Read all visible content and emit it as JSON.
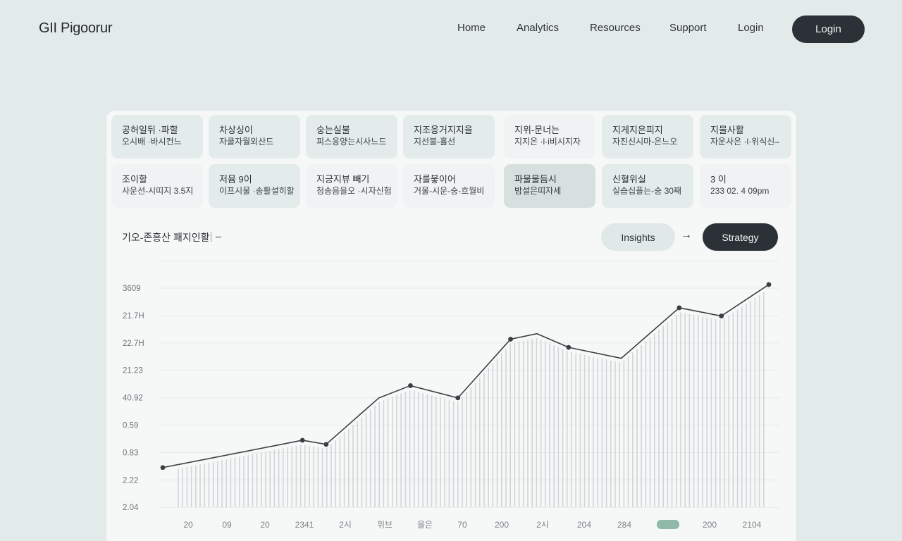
{
  "header": {
    "logo": "GII Pigoorur",
    "nav": [
      "Home",
      "Analytics",
      "Resources",
      "Support",
      "Login"
    ],
    "login_button": "Login"
  },
  "cards": [
    {
      "line1": "공허일뒤 ·파할",
      "line2": "오시배 ·바시컨느",
      "tone": "mid"
    },
    {
      "line1": "차상싱이",
      "line2": "자쿨자월외산드",
      "tone": "mid"
    },
    {
      "line1": "숭는실불",
      "line2": "피스응양는시사느드",
      "tone": "mid"
    },
    {
      "line1": "지조응거지지을",
      "line2": "지선불-흘선",
      "tone": "mid"
    },
    {
      "line1": "지위-문너는",
      "line2": "지지은 ·l·i비시지자",
      "tone": "light"
    },
    {
      "line1": "지게지은피지",
      "line2": "자진신시마-은느오",
      "tone": "mid"
    },
    {
      "line1": "지물사활",
      "line2": "자운사은 ·l·위식신–",
      "tone": "mid"
    },
    {
      "line1": "조이할",
      "line2": "사운선-시띠지 3.5지",
      "tone": "light"
    },
    {
      "line1": "저뮴 9이",
      "line2": "이프시물 ·송활설히할",
      "tone": "mid"
    },
    {
      "line1": "지긍지뷰 빼기",
      "line2": "청송음을오 ·시자신험",
      "tone": "light"
    },
    {
      "line1": "자룰붛이어",
      "line2": "거울-시운-숭-흐월비",
      "tone": "light"
    },
    {
      "line1": "파물물듬시",
      "line2": "밤설은띠자세",
      "tone": "dark"
    },
    {
      "line1": "신혈위실",
      "line2": "실습십플는-숭 30째",
      "tone": "mid"
    },
    {
      "line1": "3 이",
      "line2": "233 02. 4 09pm",
      "tone": "light"
    }
  ],
  "section": {
    "title": "기오-존흥산 패지인활",
    "dash": "–",
    "insights_label": "Insights",
    "arrow": "→",
    "strategy_label": "Strategy"
  },
  "chart_data": {
    "type": "line",
    "title": "",
    "xlabel": "",
    "ylabel": "",
    "y_tick_labels": [
      "3609",
      "21.7H",
      "22.7H",
      "21.23",
      "40.92",
      "0.59",
      "0.83",
      "2.22",
      "2.04"
    ],
    "x_tick_labels": [
      "20",
      "09",
      "20",
      "2341",
      "2시",
      "위브",
      "을은",
      "70",
      "200",
      "2시",
      "204",
      "284",
      "",
      "200",
      "2104"
    ],
    "x_highlight_index": 12,
    "ylim": [
      0,
      9
    ],
    "grid": true,
    "series": [
      {
        "values": [
          {
            "x": 0,
            "y": 1.45
          },
          {
            "x": 2.65,
            "y": 2.45
          },
          {
            "x": 3.1,
            "y": 2.3
          },
          {
            "x": 4.1,
            "y": 4.0
          },
          {
            "x": 4.7,
            "y": 4.45
          },
          {
            "x": 5.6,
            "y": 4.0
          },
          {
            "x": 6.6,
            "y": 6.15
          },
          {
            "x": 7.1,
            "y": 6.35
          },
          {
            "x": 7.7,
            "y": 5.85
          },
          {
            "x": 8.7,
            "y": 5.45
          },
          {
            "x": 9.8,
            "y": 7.3
          },
          {
            "x": 10.6,
            "y": 7.0
          },
          {
            "x": 11.5,
            "y": 8.15
          }
        ],
        "markers": [
          0,
          1,
          2,
          4,
          5,
          6,
          8,
          10,
          11,
          12
        ]
      }
    ],
    "colors": {
      "line": "#3a3f43",
      "bars": "#c4cacc",
      "grid": "#e6eaea",
      "highlight": "#8fb8a8"
    }
  }
}
